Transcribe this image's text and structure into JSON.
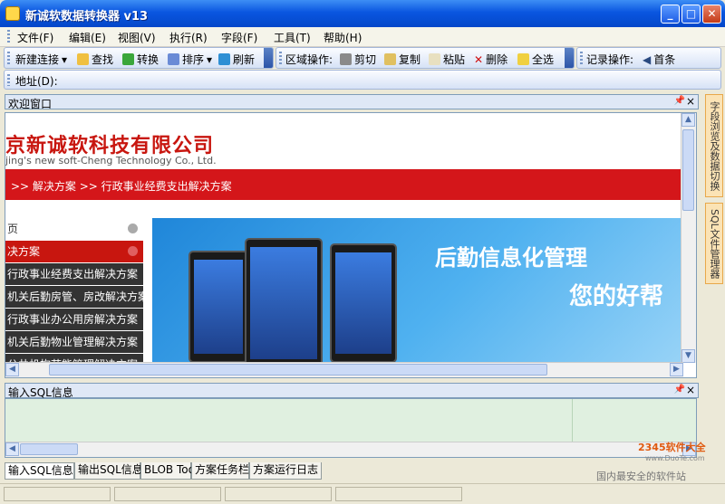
{
  "window": {
    "title": "新诚软数据转换器 v13"
  },
  "menu": [
    "文件(F)",
    "编辑(E)",
    "视图(V)",
    "执行(R)",
    "字段(F)",
    "工具(T)",
    "帮助(H)"
  ],
  "toolbar1": {
    "new_conn": "新建连接",
    "find": "查找",
    "convert": "转换",
    "sort": "排序",
    "refresh": "刷新"
  },
  "toolbar2": {
    "area_label": "区域操作:",
    "cut": "剪切",
    "copy": "复制",
    "paste": "粘贴",
    "delete": "删除",
    "select_all": "全选"
  },
  "toolbar3": {
    "record_label": "记录操作:",
    "first": "首条"
  },
  "address": {
    "label": "地址(D):"
  },
  "welcome": {
    "title": "欢迎窗口"
  },
  "page": {
    "company": "京新诚软科技有限公司",
    "company_en": "jing's new soft-Cheng Technology Co., Ltd.",
    "breadcrumb": ">> 解决方案 >> 行政事业经费支出解决方案",
    "nav": [
      "页",
      "决方案",
      "行政事业经费支出解决方案",
      "机关后勤房管、房改解决方案",
      "行政事业办公用房解决方案",
      "机关后勤物业管理解决方案",
      "公共机构节能管理解决方案"
    ],
    "banner_line1": "后勤信息化管理",
    "banner_line2": "您的好帮"
  },
  "sql_panel": {
    "title": "输入SQL信息"
  },
  "tabs": [
    "输入SQL信息",
    "输出SQL信息",
    "BLOB Tool",
    "方案任务栏",
    "方案运行日志"
  ],
  "right_panels": [
    "字段浏览及数据切换",
    "SQL文件管理器"
  ],
  "watermark": {
    "site": "2345软件大全",
    "url": "www.DuoTe.com",
    "slogan": "国内最安全的软件站"
  },
  "colors": {
    "accent_red": "#d4161a",
    "title_blue": "#0a56e0",
    "sql_bg": "#e0f0e0"
  }
}
